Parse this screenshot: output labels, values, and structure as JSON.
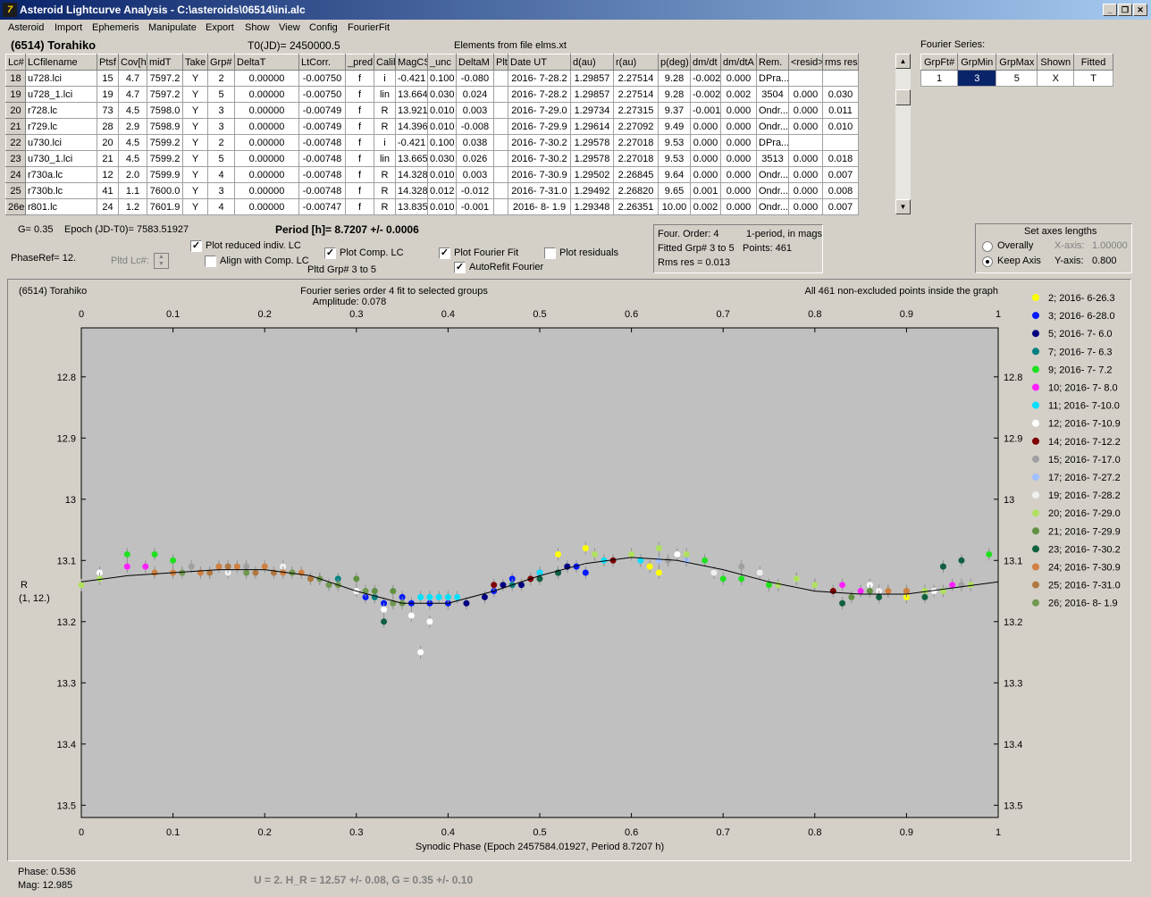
{
  "window": {
    "title": "Asteroid Lightcurve Analysis - C:\\asteroids\\06514\\ini.alc",
    "icon_text": "7"
  },
  "menu": [
    "Asteroid",
    "Import",
    "Ephemeris",
    "Manipulate",
    "Export",
    "Show",
    "View",
    "Config",
    "FourierFit"
  ],
  "header": {
    "object": "(6514) Torahiko",
    "t0": "T0(JD)= 2450000.5",
    "elements": "Elements from file elms.xt",
    "fourier_label": "Fourier Series:"
  },
  "table": {
    "columns": [
      "Lc#",
      "LCfilename",
      "Ptsf",
      "Cov[h]",
      "midT",
      "Take",
      "Grp#",
      "DeltaT",
      "LtCorr.",
      "_pred.",
      "Calib",
      "MagCS",
      "_unc",
      "DeltaM",
      "Plt",
      "Date UT",
      "d(au)",
      "r(au)",
      "p(deg)",
      "dm/dt",
      "dm/dtA",
      "Rem.",
      "<resid>",
      "rms res"
    ],
    "rows": [
      [
        "18",
        "u728.lci",
        "15",
        "4.7",
        "7597.2",
        "Y",
        "2",
        "0.00000",
        "-0.00750",
        "f",
        "i",
        "-0.421",
        "0.100",
        "-0.080",
        "",
        "2016- 7-28.2",
        "1.29857",
        "2.27514",
        "9.28",
        "-0.002",
        "0.000",
        "DPra...",
        "",
        ""
      ],
      [
        "19",
        "u728_1.lci",
        "19",
        "4.7",
        "7597.2",
        "Y",
        "5",
        "0.00000",
        "-0.00750",
        "f",
        "lin",
        "13.664",
        "0.030",
        "0.024",
        "",
        "2016- 7-28.2",
        "1.29857",
        "2.27514",
        "9.28",
        "-0.002",
        "0.002",
        "3504",
        "0.000",
        "0.030"
      ],
      [
        "20",
        "r728.lc",
        "73",
        "4.5",
        "7598.0",
        "Y",
        "3",
        "0.00000",
        "-0.00749",
        "f",
        "R",
        "13.921",
        "0.010",
        "0.003",
        "",
        "2016- 7-29.0",
        "1.29734",
        "2.27315",
        "9.37",
        "-0.001",
        "0.000",
        "Ondr...",
        "0.000",
        "0.011"
      ],
      [
        "21",
        "r729.lc",
        "28",
        "2.9",
        "7598.9",
        "Y",
        "3",
        "0.00000",
        "-0.00749",
        "f",
        "R",
        "14.396",
        "0.010",
        "-0.008",
        "",
        "2016- 7-29.9",
        "1.29614",
        "2.27092",
        "9.49",
        "0.000",
        "0.000",
        "Ondr...",
        "0.000",
        "0.010"
      ],
      [
        "22",
        "u730.lci",
        "20",
        "4.5",
        "7599.2",
        "Y",
        "2",
        "0.00000",
        "-0.00748",
        "f",
        "i",
        "-0.421",
        "0.100",
        "0.038",
        "",
        "2016- 7-30.2",
        "1.29578",
        "2.27018",
        "9.53",
        "0.000",
        "0.000",
        "DPra...",
        "",
        ""
      ],
      [
        "23",
        "u730_1.lci",
        "21",
        "4.5",
        "7599.2",
        "Y",
        "5",
        "0.00000",
        "-0.00748",
        "f",
        "lin",
        "13.665",
        "0.030",
        "0.026",
        "",
        "2016- 7-30.2",
        "1.29578",
        "2.27018",
        "9.53",
        "0.000",
        "0.000",
        "3513",
        "0.000",
        "0.018"
      ],
      [
        "24",
        "r730a.lc",
        "12",
        "2.0",
        "7599.9",
        "Y",
        "4",
        "0.00000",
        "-0.00748",
        "f",
        "R",
        "14.328",
        "0.010",
        "0.003",
        "",
        "2016- 7-30.9",
        "1.29502",
        "2.26845",
        "9.64",
        "0.000",
        "0.000",
        "Ondr...",
        "0.000",
        "0.007"
      ],
      [
        "25",
        "r730b.lc",
        "41",
        "1.1",
        "7600.0",
        "Y",
        "3",
        "0.00000",
        "-0.00748",
        "f",
        "R",
        "14.328",
        "0.012",
        "-0.012",
        "",
        "2016- 7-31.0",
        "1.29492",
        "2.26820",
        "9.65",
        "0.001",
        "0.000",
        "Ondr...",
        "0.000",
        "0.008"
      ],
      [
        "26e",
        "r801.lc",
        "24",
        "1.2",
        "7601.9",
        "Y",
        "4",
        "0.00000",
        "-0.00747",
        "f",
        "R",
        "13.835",
        "0.010",
        "-0.001",
        "",
        "2016- 8- 1.9",
        "1.29348",
        "2.26351",
        "10.00",
        "0.002",
        "0.000",
        "Ondr...",
        "0.000",
        "0.007"
      ]
    ]
  },
  "fourier_table": {
    "columns": [
      "GrpFt#",
      "GrpMin",
      "GrpMax",
      "Shown",
      "Fitted"
    ],
    "row": [
      "1",
      "3",
      "5",
      "X",
      "T"
    ]
  },
  "controls": {
    "g": "G= 0.35",
    "epoch": "Epoch (JD-T0)= 7583.51927",
    "period": "Period [h]= 8.7207 +/- 0.0006",
    "phaseref": "PhaseRef= 12.",
    "pltd_lc": "Pltd Lc#:",
    "cb_reduced": "Plot reduced indiv. LC",
    "cb_align": "Align with Comp. LC",
    "cb_comp": "Plot Comp. LC",
    "pltd_grp": "Pltd Grp#  3  to  5",
    "cb_fourier": "Plot Fourier Fit",
    "cb_autorefit": "AutoRefit Fourier",
    "cb_residuals": "Plot residuals",
    "info1": "Four. Order:  4",
    "info2": "1-period,  in mags",
    "info3": "Fitted Grp# 3 to 5",
    "info4": "Points: 461",
    "info5": "Rms res      = 0.013",
    "axes_title": "Set axes lengths",
    "overally": "Overally",
    "keep_axis": "Keep Axis",
    "xaxis_lbl": "X-axis:",
    "xaxis_val": "1.00000",
    "yaxis_lbl": "Y-axis:",
    "yaxis_val": "0.800"
  },
  "status": {
    "phase": "Phase:  0.536",
    "mag": "Mag:    12.985",
    "result": "U = 2.   H_R = 12.57 +/- 0.08, G = 0.35 +/- 0.10"
  },
  "chart_data": {
    "type": "scatter",
    "title_left": "(6514) Torahiko",
    "title_center": "Fourier series order 4 fit to selected groups",
    "subtitle": "Amplitude: 0.078",
    "title_right": "All 461 non-excluded points inside the graph",
    "xlabel": "Synodic Phase (Epoch 2457584.01927, Period 8.7207 h)",
    "ylabel": "R",
    "ylabel2": "(1, 12.)",
    "xlim": [
      0.0,
      1.0
    ],
    "ylim": [
      13.52,
      12.72
    ],
    "xticks": [
      0.0,
      0.1,
      0.2,
      0.3,
      0.4,
      0.5,
      0.6,
      0.7,
      0.8,
      0.9,
      1.0
    ],
    "yticks": [
      12.8,
      12.9,
      13.0,
      13.1,
      13.2,
      13.3,
      13.4,
      13.5
    ],
    "fourier_fit": [
      [
        0.0,
        13.135
      ],
      [
        0.05,
        13.125
      ],
      [
        0.1,
        13.12
      ],
      [
        0.15,
        13.115
      ],
      [
        0.2,
        13.115
      ],
      [
        0.25,
        13.125
      ],
      [
        0.3,
        13.15
      ],
      [
        0.35,
        13.17
      ],
      [
        0.4,
        13.17
      ],
      [
        0.45,
        13.15
      ],
      [
        0.5,
        13.125
      ],
      [
        0.55,
        13.105
      ],
      [
        0.6,
        13.095
      ],
      [
        0.65,
        13.1
      ],
      [
        0.7,
        13.115
      ],
      [
        0.75,
        13.135
      ],
      [
        0.8,
        13.15
      ],
      [
        0.85,
        13.155
      ],
      [
        0.9,
        13.155
      ],
      [
        0.95,
        13.145
      ],
      [
        1.0,
        13.135
      ]
    ],
    "series": [
      {
        "name": "2; 2016- 6-26.3",
        "color": "#ffff00",
        "points": [
          [
            0.52,
            13.09
          ],
          [
            0.55,
            13.08
          ],
          [
            0.62,
            13.11
          ],
          [
            0.63,
            13.12
          ],
          [
            0.75,
            13.14
          ],
          [
            0.9,
            13.16
          ]
        ]
      },
      {
        "name": "3; 2016- 6-28.0",
        "color": "#0018ff",
        "points": [
          [
            0.31,
            13.16
          ],
          [
            0.33,
            13.17
          ],
          [
            0.35,
            13.16
          ],
          [
            0.36,
            13.17
          ],
          [
            0.38,
            13.17
          ],
          [
            0.4,
            13.17
          ],
          [
            0.45,
            13.15
          ],
          [
            0.47,
            13.13
          ],
          [
            0.5,
            13.12
          ],
          [
            0.52,
            13.12
          ],
          [
            0.54,
            13.11
          ],
          [
            0.55,
            13.12
          ]
        ]
      },
      {
        "name": "5; 2016- 7- 6.0",
        "color": "#000080",
        "points": [
          [
            0.42,
            13.17
          ],
          [
            0.44,
            13.16
          ],
          [
            0.46,
            13.14
          ],
          [
            0.48,
            13.14
          ],
          [
            0.53,
            13.11
          ]
        ]
      },
      {
        "name": "7; 2016- 7- 6.3",
        "color": "#008080",
        "points": [
          [
            0.28,
            13.13
          ],
          [
            0.32,
            13.16
          ],
          [
            0.47,
            13.14
          ]
        ]
      },
      {
        "name": "9; 2016- 7- 7.2",
        "color": "#20e020",
        "points": [
          [
            0.05,
            13.09
          ],
          [
            0.08,
            13.09
          ],
          [
            0.1,
            13.1
          ],
          [
            0.68,
            13.1
          ],
          [
            0.7,
            13.13
          ],
          [
            0.72,
            13.13
          ],
          [
            0.75,
            13.14
          ],
          [
            0.99,
            13.09
          ]
        ]
      },
      {
        "name": "10; 2016- 7- 8.0",
        "color": "#ff20ff",
        "points": [
          [
            0.05,
            13.11
          ],
          [
            0.07,
            13.11
          ],
          [
            0.83,
            13.14
          ],
          [
            0.85,
            13.15
          ],
          [
            0.95,
            13.14
          ]
        ]
      },
      {
        "name": "11; 2016- 7-10.0",
        "color": "#00e0ff",
        "points": [
          [
            0.37,
            13.16
          ],
          [
            0.38,
            13.16
          ],
          [
            0.39,
            13.16
          ],
          [
            0.4,
            13.16
          ],
          [
            0.41,
            13.16
          ],
          [
            0.5,
            13.12
          ],
          [
            0.57,
            13.1
          ],
          [
            0.61,
            13.1
          ]
        ]
      },
      {
        "name": "12; 2016- 7-10.9",
        "color": "#ffffff",
        "points": [
          [
            0.02,
            13.12
          ],
          [
            0.14,
            13.12
          ],
          [
            0.3,
            13.15
          ],
          [
            0.33,
            13.18
          ],
          [
            0.36,
            13.19
          ],
          [
            0.37,
            13.25
          ],
          [
            0.38,
            13.2
          ],
          [
            0.65,
            13.09
          ],
          [
            0.78,
            13.13
          ],
          [
            0.86,
            13.14
          ],
          [
            0.93,
            13.15
          ]
        ]
      },
      {
        "name": "14; 2016- 7-12.2",
        "color": "#800000",
        "points": [
          [
            0.45,
            13.14
          ],
          [
            0.49,
            13.13
          ],
          [
            0.58,
            13.1
          ],
          [
            0.82,
            13.15
          ]
        ]
      },
      {
        "name": "15; 2016- 7-17.0",
        "color": "#a0a0a0",
        "points": [
          [
            0.12,
            13.11
          ],
          [
            0.18,
            13.11
          ],
          [
            0.26,
            13.13
          ],
          [
            0.64,
            13.1
          ],
          [
            0.72,
            13.11
          ],
          [
            0.88,
            13.15
          ],
          [
            0.96,
            13.14
          ]
        ]
      },
      {
        "name": "17; 2016- 7-27.2",
        "color": "#a0c0ff",
        "points": [
          [
            0.63,
            13.1
          ],
          [
            0.66,
            13.1
          ],
          [
            0.8,
            13.14
          ]
        ]
      },
      {
        "name": "19; 2016- 7-28.2",
        "color": "#f0f0f0",
        "points": [
          [
            0.16,
            13.12
          ],
          [
            0.22,
            13.11
          ],
          [
            0.69,
            13.12
          ],
          [
            0.74,
            13.12
          ],
          [
            0.87,
            13.15
          ]
        ]
      },
      {
        "name": "20; 2016- 7-29.0",
        "color": "#b0e060",
        "points": [
          [
            0.0,
            13.14
          ],
          [
            0.02,
            13.13
          ],
          [
            0.56,
            13.09
          ],
          [
            0.6,
            13.09
          ],
          [
            0.63,
            13.08
          ],
          [
            0.66,
            13.09
          ],
          [
            0.76,
            13.14
          ],
          [
            0.78,
            13.13
          ],
          [
            0.8,
            13.14
          ],
          [
            0.88,
            13.15
          ],
          [
            0.92,
            13.15
          ],
          [
            0.94,
            13.15
          ],
          [
            0.97,
            13.14
          ]
        ]
      },
      {
        "name": "21; 2016- 7-29.9",
        "color": "#609040",
        "points": [
          [
            0.3,
            13.13
          ],
          [
            0.32,
            13.15
          ],
          [
            0.34,
            13.15
          ],
          [
            0.84,
            13.16
          ],
          [
            0.86,
            13.15
          ],
          [
            0.9,
            13.15
          ]
        ]
      },
      {
        "name": "23; 2016- 7-30.2",
        "color": "#106040",
        "points": [
          [
            0.33,
            13.2
          ],
          [
            0.5,
            13.13
          ],
          [
            0.52,
            13.12
          ],
          [
            0.83,
            13.17
          ],
          [
            0.87,
            13.16
          ],
          [
            0.92,
            13.16
          ],
          [
            0.94,
            13.11
          ],
          [
            0.96,
            13.1
          ]
        ]
      },
      {
        "name": "24; 2016- 7-30.9",
        "color": "#d08040",
        "points": [
          [
            0.08,
            13.12
          ],
          [
            0.1,
            13.12
          ],
          [
            0.13,
            13.12
          ],
          [
            0.15,
            13.11
          ],
          [
            0.17,
            13.11
          ],
          [
            0.2,
            13.11
          ],
          [
            0.22,
            13.12
          ],
          [
            0.24,
            13.12
          ],
          [
            0.88,
            13.15
          ],
          [
            0.9,
            13.15
          ]
        ]
      },
      {
        "name": "25; 2016- 7-31.0",
        "color": "#b07840",
        "points": [
          [
            0.14,
            13.12
          ],
          [
            0.16,
            13.11
          ],
          [
            0.19,
            13.12
          ],
          [
            0.21,
            13.12
          ],
          [
            0.23,
            13.12
          ],
          [
            0.25,
            13.13
          ]
        ]
      },
      {
        "name": "26; 2016- 8- 1.9",
        "color": "#709850",
        "points": [
          [
            0.11,
            13.12
          ],
          [
            0.18,
            13.12
          ],
          [
            0.23,
            13.12
          ],
          [
            0.26,
            13.13
          ],
          [
            0.27,
            13.14
          ],
          [
            0.28,
            13.14
          ],
          [
            0.31,
            13.15
          ],
          [
            0.34,
            13.17
          ],
          [
            0.35,
            13.17
          ]
        ]
      }
    ]
  }
}
